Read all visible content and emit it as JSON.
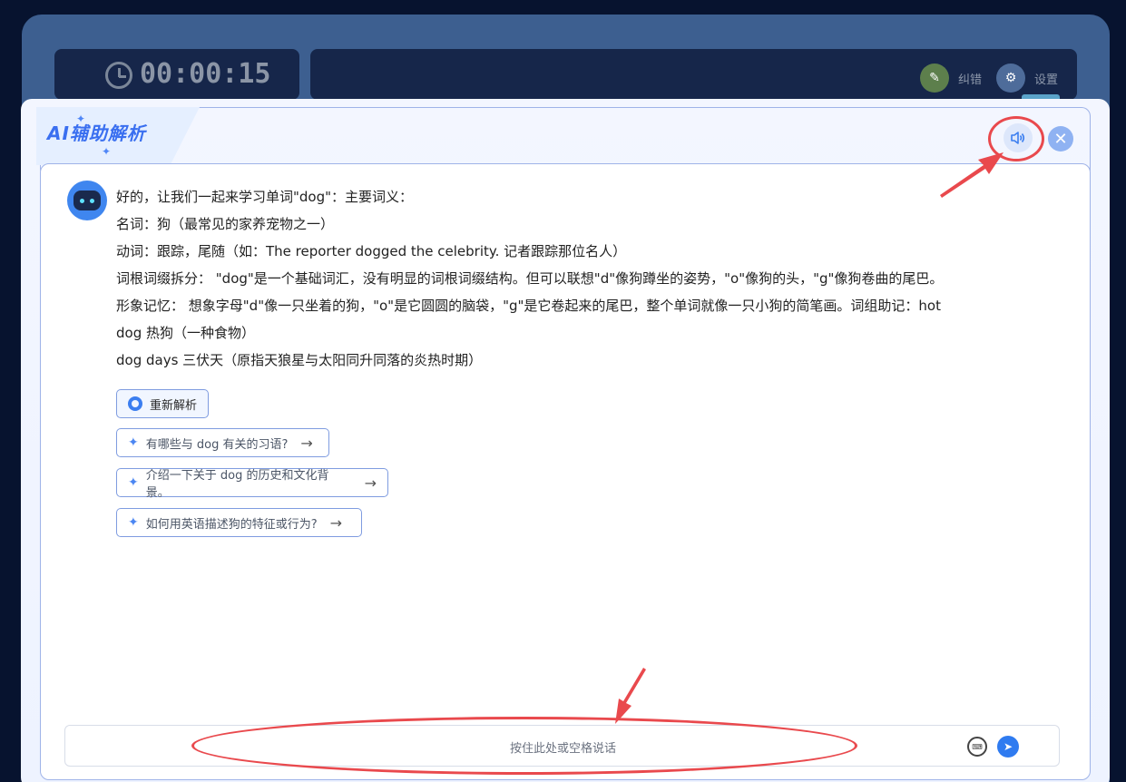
{
  "timer": {
    "value": "00:00:15"
  },
  "topbar": {
    "correct_label": "纠错",
    "settings_label": "设置"
  },
  "panel": {
    "title": "AI辅助解析",
    "close_symbol": "✕"
  },
  "message": {
    "lines": [
      "好的，让我们一起来学习单词\"dog\"：主要词义：",
      "名词：狗（最常见的家养宠物之一）",
      "动词：跟踪，尾随（如：The reporter dogged the celebrity. 记者跟踪那位名人）",
      "词根词缀拆分： \"dog\"是一个基础词汇，没有明显的词根词缀结构。但可以联想\"d\"像狗蹲坐的姿势，\"o\"像狗的头，\"g\"像狗卷曲的尾巴。",
      "形象记忆： 想象字母\"d\"像一只坐着的狗，\"o\"是它圆圆的脑袋，\"g\"是它卷起来的尾巴，整个单词就像一只小狗的简笔画。词组助记：hot",
      "dog 热狗（一种食物）",
      "dog days 三伏天（原指天狼星与太阳同升同落的炎热时期）"
    ]
  },
  "actions": {
    "reparse_label": "重新解析",
    "suggestions": [
      "有哪些与 dog 有关的习语?",
      "介绍一下关于 dog 的历史和文化背景。",
      "如何用英语描述狗的特征或行为?"
    ]
  },
  "input": {
    "placeholder": "按住此处或空格说话"
  },
  "colors": {
    "accent": "#3b7ef0",
    "annotation": "#e9494d"
  }
}
